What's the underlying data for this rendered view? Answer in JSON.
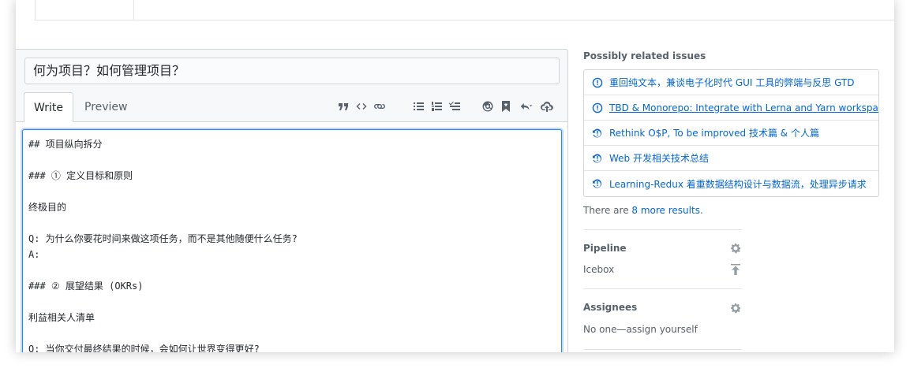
{
  "issue_title": "何为项目？如何管理项目？",
  "tabs": {
    "write": "Write",
    "preview": "Preview"
  },
  "toolbar_icons": [
    "quote-icon",
    "code-icon",
    "link-icon",
    "unordered-list-icon",
    "ordered-list-icon",
    "task-list-icon",
    "mention-icon",
    "bookmark-icon",
    "reply-icon",
    "upload-icon"
  ],
  "body_text": "## 项目纵向拆分\n\n### ① 定义目标和原则\n\n终极目的\n\nQ: 为什么你要花时间来做这项任务，而不是其他随便什么任务?\nA:\n\n### ② 展望结果 (OKRs)\n\n利益相关人清单\n\nQ: 当你交付最终结果的时候，会如何让世界变得更好?",
  "sidebar": {
    "related_title": "Possibly related issues",
    "related": [
      {
        "label": "重回纯文本，兼谈电子化时代 GUI 工具的弊端与反思 GTD",
        "icon": "issue-opened-icon",
        "underlined": false
      },
      {
        "label": "TBD & Monorepo: Integrate with Lerna and Yarn workspace",
        "icon": "issue-opened-icon",
        "underlined": true
      },
      {
        "label": "Rethink O$P, To be improved 技术篇 & 个人篇",
        "icon": "issue-reopened-icon",
        "underlined": false
      },
      {
        "label": "Web 开发相关技术总结",
        "icon": "issue-reopened-icon",
        "underlined": false
      },
      {
        "label": "Learning-Redux 着重数据结构设计与数据流，处理异步请求",
        "icon": "issue-reopened-icon",
        "underlined": false
      }
    ],
    "more_prefix": "There are ",
    "more_link": "8 more results",
    "more_suffix": ".",
    "pipeline_title": "Pipeline",
    "pipeline_value": "Icebox",
    "assignees_title": "Assignees",
    "assignees_value": "No one—assign yourself"
  },
  "colors": {
    "link": "#0366d6",
    "focus": "#2188ff",
    "muted": "#586069"
  }
}
